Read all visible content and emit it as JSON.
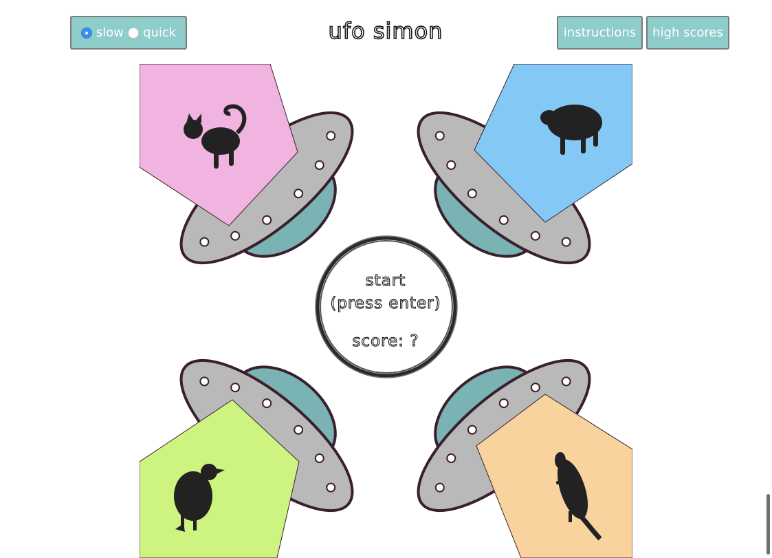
{
  "title": "ufo simon",
  "speed": {
    "options": [
      {
        "label": "slow",
        "selected": true
      },
      {
        "label": "quick",
        "selected": false
      }
    ]
  },
  "buttons": {
    "instructions": "instructions",
    "high_scores": "high scores"
  },
  "center": {
    "start_label": "start",
    "start_hint": "(press enter)",
    "score_label": "score: ?"
  },
  "beams": {
    "top_left": {
      "color": "#f1b3df",
      "animal": "cat"
    },
    "top_right": {
      "color": "#84c8f5",
      "animal": "sheep"
    },
    "bottom_left": {
      "color": "#cdf381",
      "animal": "duck"
    },
    "bottom_right": {
      "color": "#f8d39e",
      "animal": "platypus"
    }
  },
  "colors": {
    "panel": "#8fcdca",
    "ufo_body": "#b9b9b9",
    "ufo_dome": "#7ab3b3",
    "outline": "#3a1f2c"
  }
}
